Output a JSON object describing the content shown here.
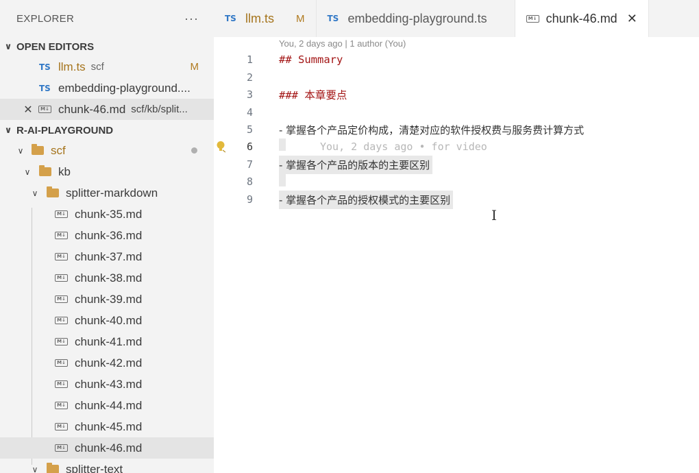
{
  "explorer": {
    "title": "EXPLORER",
    "more": "···",
    "open_editors": {
      "label": "OPEN EDITORS",
      "items": [
        {
          "badge": "TS",
          "name": "llm.ts",
          "desc": "scf",
          "status": "M"
        },
        {
          "badge": "TS",
          "name": "embedding-playground....",
          "desc": "",
          "status": ""
        },
        {
          "badge": "M↓",
          "name": "chunk-46.md",
          "desc": "scf/kb/split...",
          "status": "",
          "close": "✕"
        }
      ]
    },
    "workspace": {
      "label": "R-AI-PLAYGROUND",
      "folders": {
        "scf": "scf",
        "kb": "kb",
        "splitter_markdown": "splitter-markdown",
        "splitter_text": "splitter-text"
      },
      "files": [
        "chunk-35.md",
        "chunk-36.md",
        "chunk-37.md",
        "chunk-38.md",
        "chunk-39.md",
        "chunk-40.md",
        "chunk-41.md",
        "chunk-42.md",
        "chunk-43.md",
        "chunk-44.md",
        "chunk-45.md",
        "chunk-46.md"
      ]
    }
  },
  "tabs": [
    {
      "badge": "TS",
      "label": "llm.ts",
      "flag": "M"
    },
    {
      "badge": "TS",
      "label": "embedding-playground.ts",
      "flag": ""
    },
    {
      "badge": "M↓",
      "label": "chunk-46.md",
      "close": "✕"
    }
  ],
  "editor": {
    "blame": "You, 2 days ago | 1 author (You)",
    "ghost_blame": "You, 2 days ago • for video",
    "lines": [
      {
        "n": "1",
        "text": "## Summary"
      },
      {
        "n": "2",
        "text": ""
      },
      {
        "n": "3",
        "text": "### 本章要点"
      },
      {
        "n": "4",
        "text": ""
      },
      {
        "n": "5",
        "text": "- 掌握各个产品定价构成，清楚对应的软件授权费与服务费计算方式"
      },
      {
        "n": "6",
        "text": ""
      },
      {
        "n": "7",
        "text": "- 掌握各个产品的版本的主要区别"
      },
      {
        "n": "8",
        "text": ""
      },
      {
        "n": "9",
        "text": "- 掌握各个产品的授权模式的主要区别"
      }
    ]
  },
  "colors": {
    "sidebar_bg": "#f3f3f3",
    "ts_blue": "#3178c6",
    "heading_red": "#a31515",
    "modified": "#b07a1f",
    "folder": "#d4a04a"
  },
  "icons": [
    "more-icon",
    "chevron-down-icon",
    "typescript-icon",
    "markdown-icon",
    "folder-icon",
    "close-icon",
    "lightbulb-icon",
    "text-cursor-icon"
  ]
}
